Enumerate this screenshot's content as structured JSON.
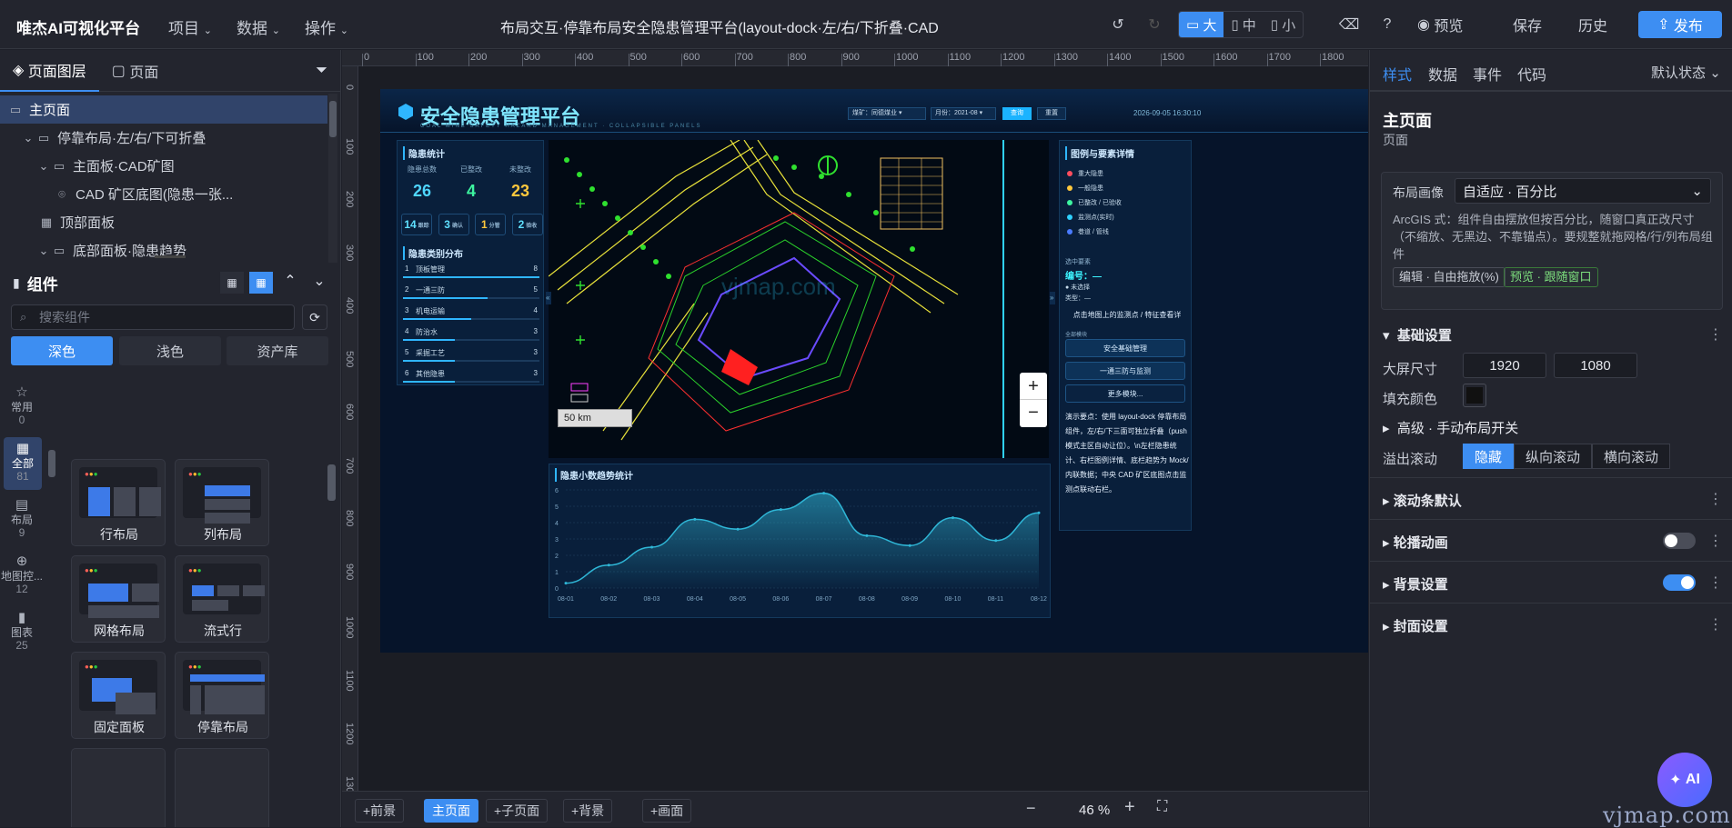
{
  "app": {
    "brand": "唯杰AI可视化平台",
    "menus": [
      "项目",
      "数据",
      "操作"
    ],
    "doc_title": "布局交互·停靠布局安全隐患管理平台(layout-dock·左/右/下折叠·CAD"
  },
  "toolbar": {
    "size_options": [
      "大",
      "中",
      "小"
    ],
    "preview": "预览",
    "save": "保存",
    "history": "历史",
    "publish": "发布"
  },
  "left": {
    "tabs": [
      "页面图层",
      "页面"
    ],
    "tree": [
      {
        "label": "主页面",
        "depth": 0,
        "icon": "monitor-icon",
        "selected": true
      },
      {
        "label": "停靠布局·左/右/下可折叠",
        "depth": 1,
        "icon": "folder-icon"
      },
      {
        "label": "主面板·CAD矿图",
        "depth": 2,
        "icon": "folder-icon"
      },
      {
        "label": "CAD 矿区底图(隐患一张...",
        "depth": 3,
        "icon": "map-pin-icon"
      },
      {
        "label": "顶部面板",
        "depth": 2,
        "icon": "grid-icon"
      },
      {
        "label": "底部面板·隐患趋势",
        "depth": 2,
        "icon": "folder-icon"
      }
    ],
    "components_title": "组件",
    "search_placeholder": "搜索组件",
    "themes": [
      "深色",
      "浅色",
      "资产库"
    ],
    "categories": [
      {
        "label": "常用",
        "count": "0",
        "icon": "star-icon"
      },
      {
        "label": "全部",
        "count": "81",
        "icon": "grid-icon",
        "selected": true
      },
      {
        "label": "布局",
        "count": "9",
        "icon": "layout-icon"
      },
      {
        "label": "地图控...",
        "count": "12",
        "icon": "crosshair-icon"
      },
      {
        "label": "图表",
        "count": "25",
        "icon": "bar-chart-icon"
      }
    ],
    "cards": [
      "行布局",
      "列布局",
      "网格布局",
      "流式行",
      "固定面板",
      "停靠布局"
    ]
  },
  "rulers": {
    "h": [
      "0",
      "100",
      "200",
      "300",
      "400",
      "500",
      "600",
      "700",
      "800",
      "900",
      "1000",
      "1100",
      "1200",
      "1300",
      "1400",
      "1500",
      "1600",
      "1700",
      "1800",
      "1900"
    ],
    "v": [
      "0",
      "100",
      "200",
      "300",
      "400",
      "500",
      "600",
      "700",
      "800",
      "900",
      "1000",
      "1100",
      "1200",
      "1300"
    ]
  },
  "dashboard": {
    "title": "安全隐患管理平台",
    "subtitle": "COAL MINE SAFETY HAZARD MANAGEMENT · COLLAPSIBLE PANELS",
    "mine_label": "煤矿：同德煤业 ▾",
    "month_label": "月份：2021-08 ▾",
    "query": "查询",
    "reset": "重置",
    "datetime": "2026-09-05 16:30:10",
    "left_title": "隐患统计",
    "kpis": [
      {
        "label": "隐患总数",
        "value": "26",
        "color": "#4fd6ff"
      },
      {
        "label": "已整改",
        "value": "4",
        "color": "#3df5a0"
      },
      {
        "label": "未整改",
        "value": "23",
        "color": "#ffc83d"
      }
    ],
    "badges": [
      {
        "num": "14",
        "label": "跟踪"
      },
      {
        "num": "3",
        "label": "确认"
      },
      {
        "num": "1",
        "label": "分管"
      },
      {
        "num": "2",
        "label": "验收"
      }
    ],
    "dist_title": "隐患类别分布",
    "dist": [
      {
        "idx": "1",
        "name": "顶板管理",
        "val": "8",
        "pct": 1.0
      },
      {
        "idx": "2",
        "name": "一通三防",
        "val": "5",
        "pct": 0.62
      },
      {
        "idx": "3",
        "name": "机电运输",
        "val": "4",
        "pct": 0.5
      },
      {
        "idx": "4",
        "name": "防治水",
        "val": "3",
        "pct": 0.38
      },
      {
        "idx": "5",
        "name": "采掘工艺",
        "val": "3",
        "pct": 0.38
      },
      {
        "idx": "6",
        "name": "其他隐患",
        "val": "3",
        "pct": 0.38
      }
    ],
    "scale": "50 km",
    "right_title": "图例与要素详情",
    "legend": [
      {
        "name": "重大隐患",
        "color": "#ff4d5e"
      },
      {
        "name": "一般隐患",
        "color": "#ffc83d"
      },
      {
        "name": "已整改 / 已验收",
        "color": "#3df5a0"
      },
      {
        "name": "监测点(实时)",
        "color": "#2fd1ff"
      },
      {
        "name": "巷道 / 管线",
        "color": "#4a7bff"
      }
    ],
    "sel_title": "选中要素",
    "sel_id": "编号：—",
    "sel_unselected": "● 未选择",
    "sel_type": "类型：—",
    "hint": "点击地图上的监测点 / 特征查看详",
    "modules_title": "全部模块",
    "modules": [
      "安全基础管理",
      "一通三防与监测",
      "更多模块..."
    ],
    "note": "演示要点：使用 layout-dock 停靠布局组件，左/右/下三面可独立折叠（push 模式主区自动让位）。\\n左栏隐患统计、右栏图例详情、底栏趋势为 Mock/内联数据；中央 CAD 矿区底图点击监测点联动右栏。",
    "trend_title": "隐患小数趋势统计"
  },
  "chart_data": {
    "type": "area",
    "title": "隐患小数趋势统计",
    "x": [
      "08-01",
      "08-02",
      "08-03",
      "08-04",
      "08-05",
      "08-06",
      "08-07",
      "08-08",
      "08-09",
      "08-10",
      "08-11",
      "08-12"
    ],
    "values": [
      0.3,
      1.4,
      2.5,
      4.2,
      3.6,
      4.8,
      5.8,
      3.2,
      2.6,
      4.3,
      2.9,
      4.6
    ],
    "yticks": [
      "0",
      "1",
      "2",
      "3",
      "4",
      "5",
      "6"
    ],
    "ylim": [
      0,
      6
    ],
    "color": "#2fb6d6"
  },
  "bottom": {
    "buttons": [
      "+前景",
      "主页面",
      "+子页面",
      "+背景",
      "+画面"
    ],
    "zoom": "46 %"
  },
  "right": {
    "tabs": [
      "样式",
      "数据",
      "事件",
      "代码"
    ],
    "state": "默认状态",
    "page_title": "主页面",
    "page_sub": "页面",
    "layout_label": "布局画像",
    "layout_value": "自适应 · 百分比",
    "layout_desc": "ArcGIS 式：组件自由摆放但按百分比，随窗口真正改尺寸（不缩放、无黑边、不靠锚点）。要规整就拖网格/行/列布局组件",
    "tag_edit": "编辑 · 自由拖放(%)",
    "tag_preview": "预览 · 跟随窗口",
    "basic": "基础设置",
    "size_label": "大屏尺寸",
    "width": "1920",
    "height": "1080",
    "fill_label": "填充颜色",
    "advanced": "高级 · 手动布局开关",
    "overflow_label": "溢出滚动",
    "overflow": [
      "隐藏",
      "纵向滚动",
      "横向滚动"
    ],
    "sections": [
      {
        "label": "滚动条默认",
        "toggle": null
      },
      {
        "label": "轮播动画",
        "toggle": false
      },
      {
        "label": "背景设置",
        "toggle": true
      },
      {
        "label": "封面设置",
        "toggle": null
      }
    ],
    "ai": "AI"
  },
  "watermark": "vjmap.com"
}
